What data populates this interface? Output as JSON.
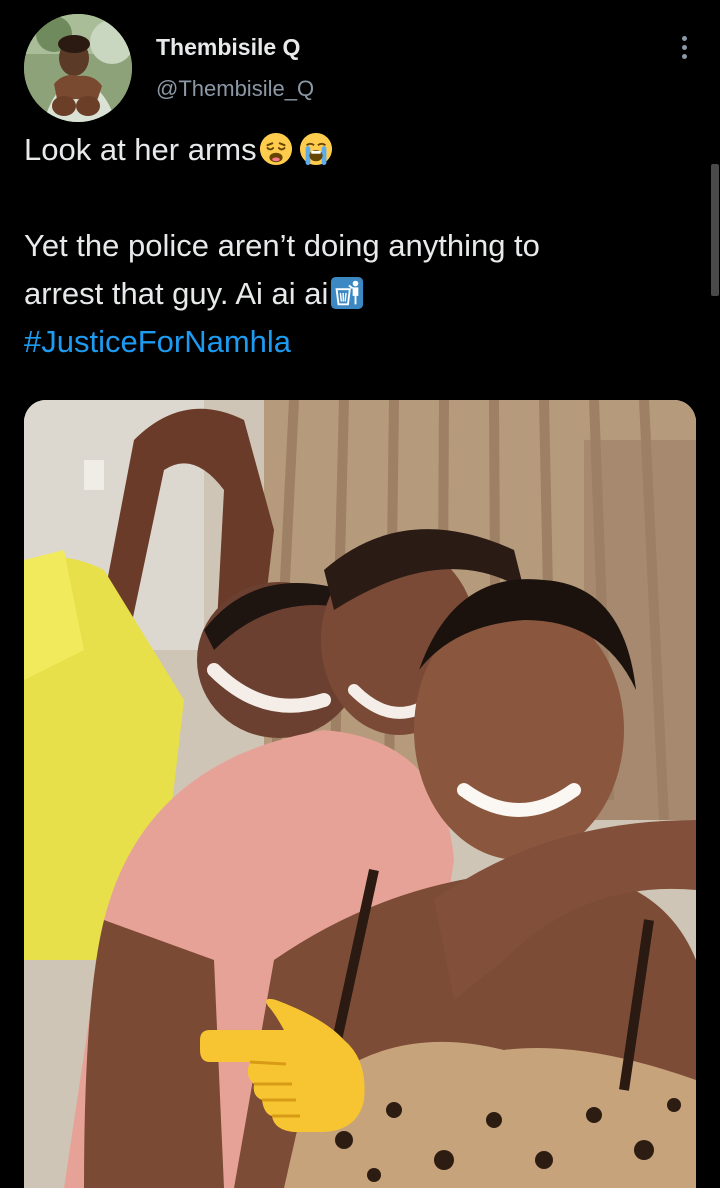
{
  "tweet": {
    "author": {
      "display_name": "Thembisile Q",
      "handle": "@Thembisile_Q",
      "avatar_icon": "profile-avatar"
    },
    "text_lines": [
      "Look at her arms",
      "Yet the police aren’t doing anything to",
      "arrest that guy.  Ai ai ai"
    ],
    "emojis": [
      "weary-face-icon",
      "loudly-crying-face-icon",
      "wastebasket-icon"
    ],
    "hashtag": "#JusticeForNamhla",
    "more_icon": "more-options-icon",
    "media": {
      "type": "photo",
      "overlay_icon": "pointing-hand-icon"
    }
  },
  "colors": {
    "background": "#000000",
    "text": "#e7e9ea",
    "secondary_text": "#8b98a5",
    "link": "#1d9bf0"
  }
}
